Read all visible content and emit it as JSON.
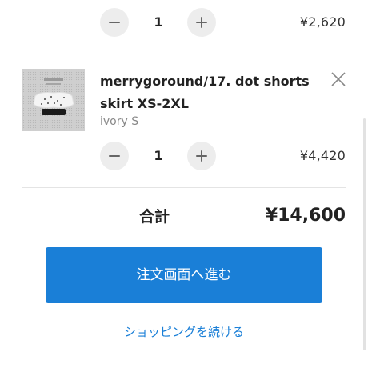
{
  "cart": {
    "items": [
      {
        "quantity": "1",
        "price": "¥2,620",
        "decrease_icon": "minus-icon",
        "increase_icon": "plus-icon"
      },
      {
        "title": "merrygoround/17. dot shorts skirt XS-2XL",
        "variant": "ivory S",
        "quantity": "1",
        "price": "¥4,420",
        "remove_icon": "close-icon",
        "decrease_icon": "minus-icon",
        "increase_icon": "plus-icon"
      }
    ]
  },
  "summary": {
    "total_label": "合計",
    "total_value": "¥14,600"
  },
  "actions": {
    "checkout_label": "注文画面へ進む",
    "continue_label": "ショッピングを続ける"
  },
  "colors": {
    "accent": "#1a7fd7",
    "button_bg": "#ededed",
    "divider": "#e4e4e4",
    "muted_text": "#888888"
  }
}
